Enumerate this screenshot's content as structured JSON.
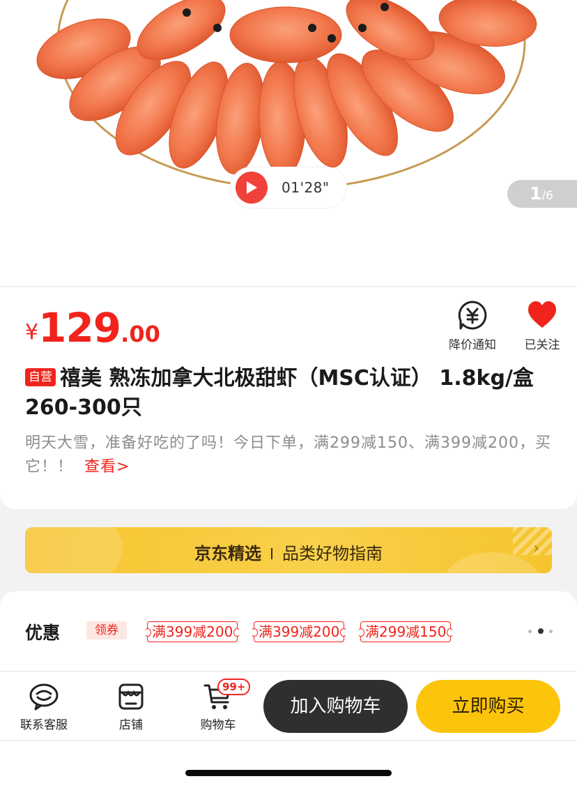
{
  "gallery": {
    "video_duration": "01'28\"",
    "page_current": "1",
    "page_total": "/6"
  },
  "product": {
    "currency": "¥",
    "price_int": "129",
    "price_dec": ".00",
    "self_operated_tag": "自营",
    "title": "禧美 熟冻加拿大北极甜虾（MSC认证） 1.8kg/盒 260-300只",
    "promo_text": "明天大雪，准备好吃的了吗！今日下单，满299减150、满399减200，买它！！",
    "promo_more": "查看>"
  },
  "actions": {
    "price_alert_label": "降价通知",
    "follow_label": "已关注"
  },
  "banner": {
    "main": "京东精选",
    "sub": "品类好物指南",
    "arrow": "›"
  },
  "coupons": {
    "title": "优惠",
    "get_label": "领券",
    "items": [
      "满399减200",
      "满399减200",
      "满299减150"
    ]
  },
  "bottom_bar": {
    "service_label": "联系客服",
    "shop_label": "店铺",
    "cart_label": "购物车",
    "cart_badge": "99+",
    "add_to_cart": "加入购物车",
    "buy_now": "立即购买"
  },
  "colors": {
    "accent_red": "#f0241c",
    "buy_yellow": "#fcc40b",
    "cart_dark": "#2f2f2f"
  }
}
